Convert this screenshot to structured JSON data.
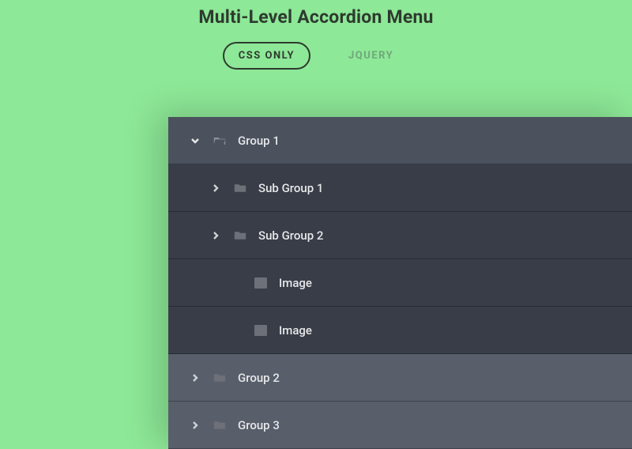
{
  "title": "Multi-Level Accordion Menu",
  "tabs": {
    "css": "CSS ONLY",
    "jquery": "JQUERY"
  },
  "menu": {
    "group1": "Group 1",
    "sub1": "Sub Group 1",
    "sub2": "Sub Group 2",
    "image1": "Image",
    "image2": "Image",
    "group2": "Group 2",
    "group3": "Group 3"
  }
}
